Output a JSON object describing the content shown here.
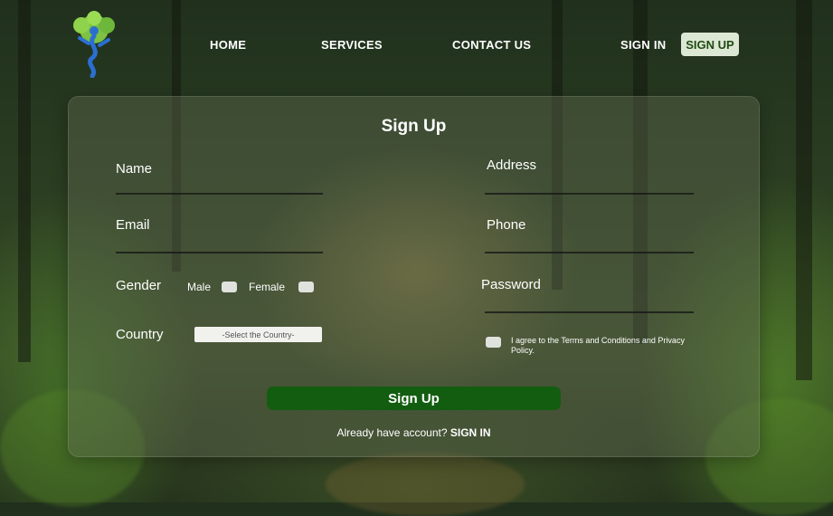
{
  "nav": {
    "links": [
      "HOME",
      "SERVICES",
      "CONTACT US"
    ],
    "sign_in": "SIGN IN",
    "sign_up": "SIGN UP"
  },
  "form": {
    "title": "Sign Up",
    "name_label": "Name",
    "address_label": "Address",
    "email_label": "Email",
    "phone_label": "Phone",
    "gender_label": "Gender",
    "male_label": "Male",
    "female_label": "Female",
    "password_label": "Password",
    "country_label": "Country",
    "country_select": "-Select the Country-",
    "terms_text": "I agree to the Terms and Conditions and Privacy Policy.",
    "submit_label": "Sign Up",
    "footer_text": "Already have account?",
    "footer_link": "SIGN IN"
  },
  "colors": {
    "submit_button": "#135d10",
    "signup_nav_bg": "#dde8d4",
    "signup_nav_text": "#1f4a14"
  },
  "icons": {
    "logo": "tree-person-logo-icon"
  }
}
